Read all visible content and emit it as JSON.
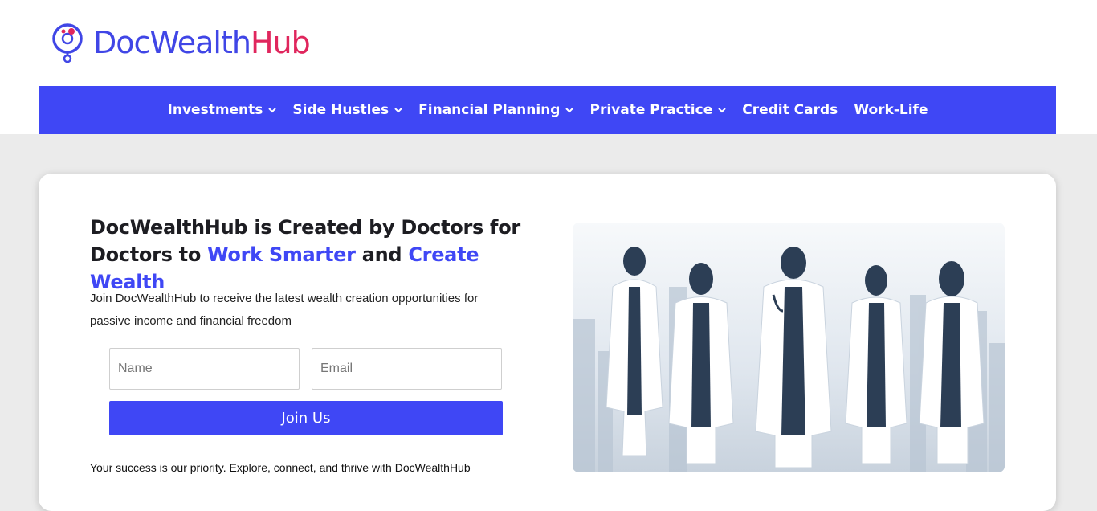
{
  "brand": {
    "name_part1": "DocWealth",
    "name_part2": "Hub",
    "logo_icon": "stethoscope-coin-icon",
    "primary_color": "#3f47f5",
    "accent_color": "#e0265d"
  },
  "nav": {
    "items": [
      {
        "label": "Investments",
        "has_dropdown": true
      },
      {
        "label": "Side Hustles",
        "has_dropdown": true
      },
      {
        "label": "Financial Planning",
        "has_dropdown": true
      },
      {
        "label": "Private Practice",
        "has_dropdown": true
      },
      {
        "label": "Credit Cards",
        "has_dropdown": false
      },
      {
        "label": "Work-Life",
        "has_dropdown": false
      }
    ]
  },
  "hero": {
    "headline_part1": "DocWealthHub is Created by Doctors for Doctors to ",
    "highlight1": "Work Smarter",
    "headline_and": " and ",
    "highlight2": "Create Wealth",
    "subtext": "Join DocWealthHub to receive the latest wealth creation opportunities for passive income and financial freedom",
    "image_subject": "doctors-silhouette-illustration"
  },
  "signup": {
    "name_placeholder": "Name",
    "email_placeholder": "Email",
    "button_label": "Join Us"
  },
  "footer_note": "Your success is our priority. Explore, connect, and thrive with DocWealthHub"
}
